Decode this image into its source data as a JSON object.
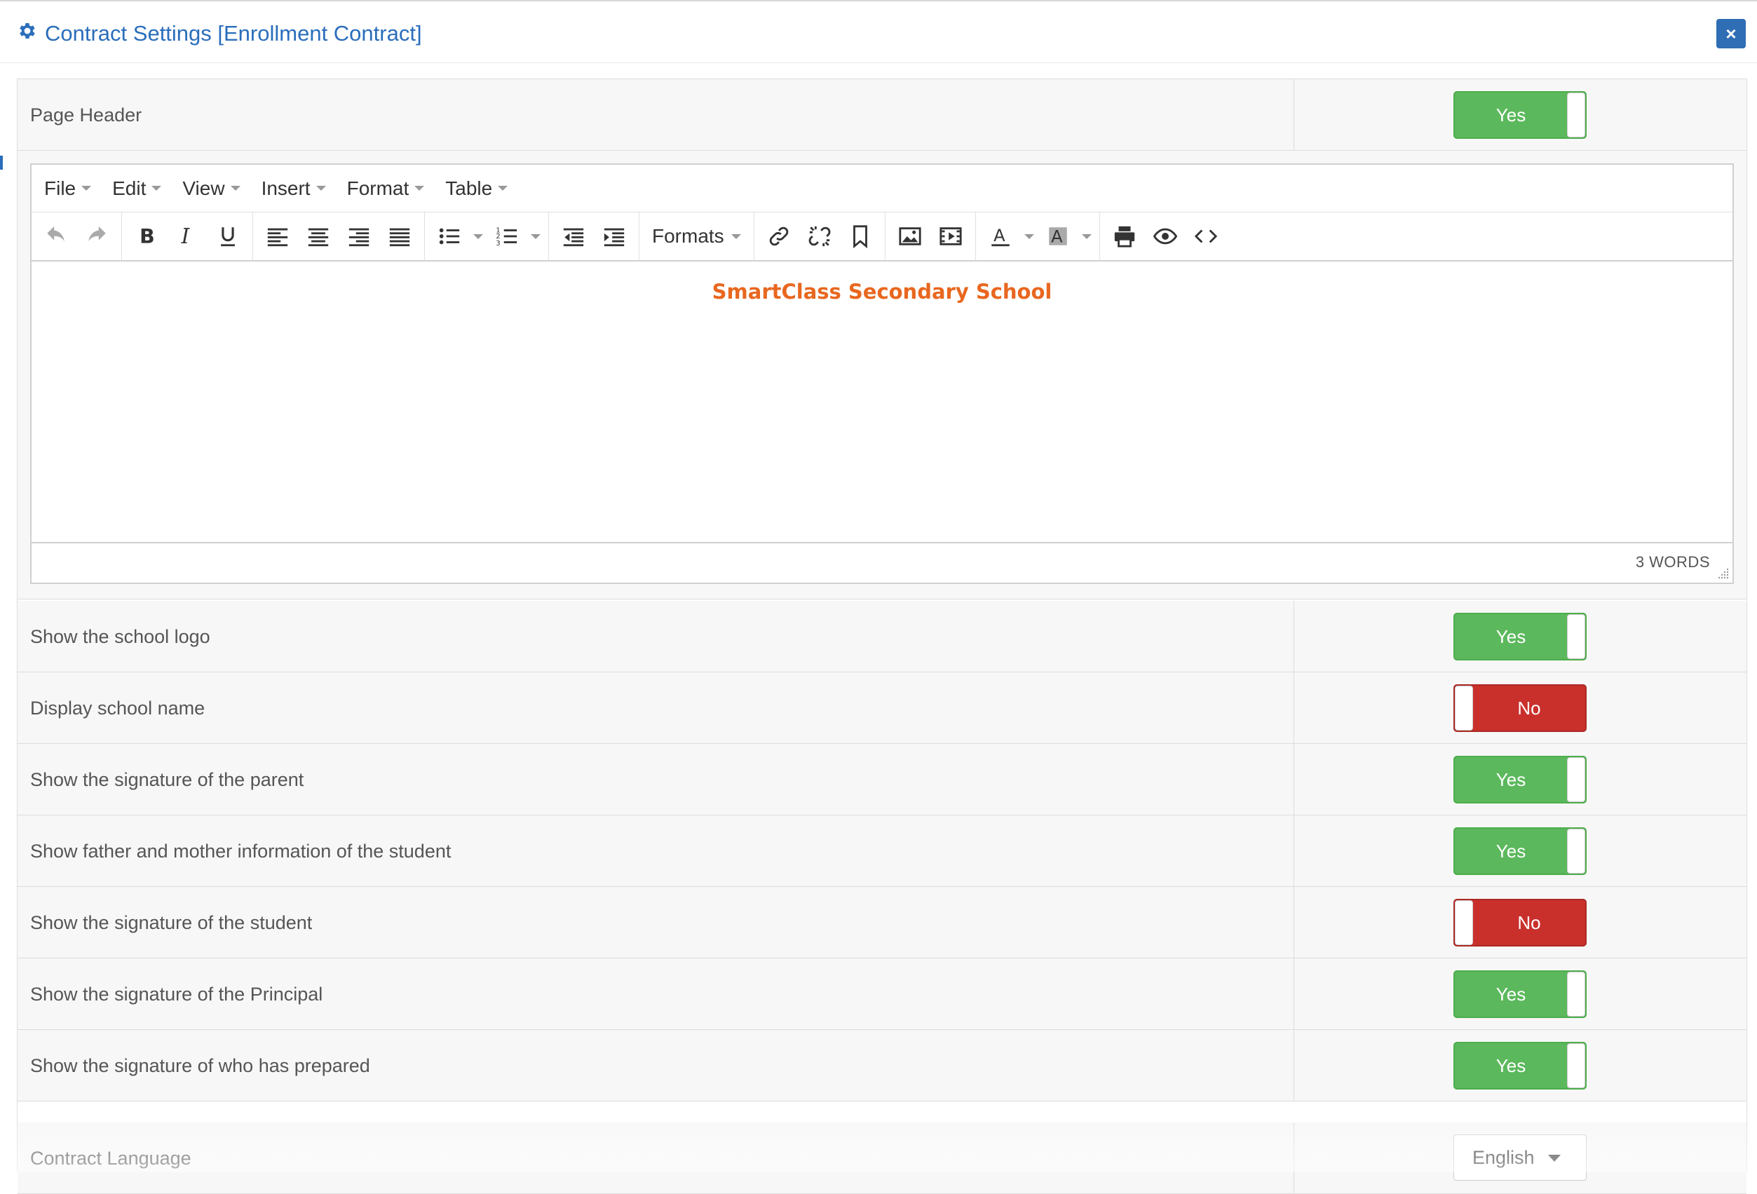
{
  "modal": {
    "title": "Contract Settings [Enrollment Contract]",
    "close_label": "×"
  },
  "page_header": {
    "label": "Page Header",
    "toggle": "Yes"
  },
  "editor": {
    "menus": [
      "File",
      "Edit",
      "View",
      "Insert",
      "Format",
      "Table"
    ],
    "formats_label": "Formats",
    "content": "SmartClass Secondary School",
    "word_count": "3 WORDS"
  },
  "settings": [
    {
      "label": "Show the school logo",
      "value": "Yes",
      "on": true
    },
    {
      "label": "Display school name",
      "value": "No",
      "on": false
    },
    {
      "label": "Show the signature of the parent",
      "value": "Yes",
      "on": true
    },
    {
      "label": "Show father and mother information of the student",
      "value": "Yes",
      "on": true
    },
    {
      "label": "Show the signature of the student",
      "value": "No",
      "on": false
    },
    {
      "label": "Show the signature of the Principal",
      "value": "Yes",
      "on": true
    },
    {
      "label": "Show the signature of who has prepared",
      "value": "Yes",
      "on": true
    }
  ],
  "contract_language": {
    "label": "Contract Language",
    "value": "English"
  },
  "colors": {
    "accent": "#2a6ebb",
    "yes": "#5cb85c",
    "no": "#c9302c",
    "editor_text": "#e8671f"
  }
}
